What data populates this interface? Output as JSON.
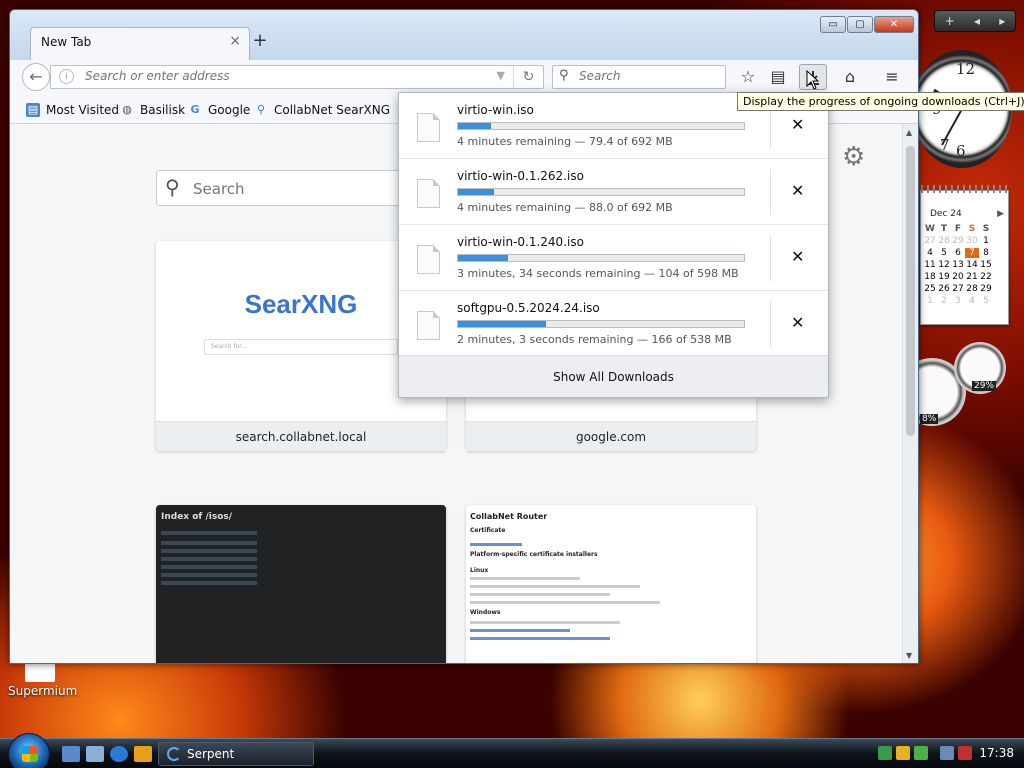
{
  "browser": {
    "tab_title": "New Tab",
    "tab_close": "×",
    "new_tab": "+",
    "address_placeholder": "Search or enter address",
    "search_placeholder": "Search",
    "tooltip": "Display the progress of ongoing downloads (Ctrl+J)",
    "window_buttons": {
      "minimize": "▭",
      "maximize": "▢",
      "close": "✕"
    }
  },
  "bookmarks": [
    {
      "label": "Most Visited",
      "icon": "bookmarks-folder-icon"
    },
    {
      "label": "Basilisk",
      "icon": "globe-icon"
    },
    {
      "label": "Google",
      "icon": "google-icon"
    },
    {
      "label": "CollabNet SearXNG",
      "icon": "searxng-icon"
    }
  ],
  "newtab": {
    "search_placeholder": "Search",
    "tiles": [
      {
        "label": "search.collabnet.local",
        "logo": "SearXNG",
        "box_text": "Search for..."
      },
      {
        "label": "google.com"
      },
      {
        "label": "",
        "heading": "Index of /isos/"
      },
      {
        "label": "",
        "heading": "CollabNet Router",
        "sections": [
          "Certificate",
          "Platform-specific certificate installers",
          "Linux",
          "Windows"
        ]
      }
    ]
  },
  "downloads": {
    "items": [
      {
        "name": "virtio-win.iso",
        "status": "4 minutes remaining — 79.4 of 692 MB",
        "progress": 0.115
      },
      {
        "name": "virtio-win-0.1.262.iso",
        "status": "4 minutes remaining — 88.0 of 692 MB",
        "progress": 0.127
      },
      {
        "name": "virtio-win-0.1.240.iso",
        "status": "3 minutes, 34 seconds remaining — 104 of 598 MB",
        "progress": 0.174
      },
      {
        "name": "softgpu-0.5.2024.24.iso",
        "status": "2 minutes, 3 seconds remaining — 166 of 538 MB",
        "progress": 0.309
      }
    ],
    "cancel_glyph": "✕",
    "show_all": "Show All Downloads"
  },
  "gadgets": {
    "calendar": {
      "month": "Dec 24",
      "weekdays": [
        "W",
        "T",
        "F",
        "S",
        "S"
      ],
      "selected_day": "7"
    },
    "cpu_value": "8%",
    "mem_value": "29%"
  },
  "desktop": {
    "icon_label": "Supermium"
  },
  "taskbar": {
    "task_label": "Serpent",
    "clock": "17:38"
  },
  "colors": {
    "accent": "#3c8fde",
    "tab_bg": "#f5f7fa",
    "titlebar": "#c6d9ef"
  }
}
